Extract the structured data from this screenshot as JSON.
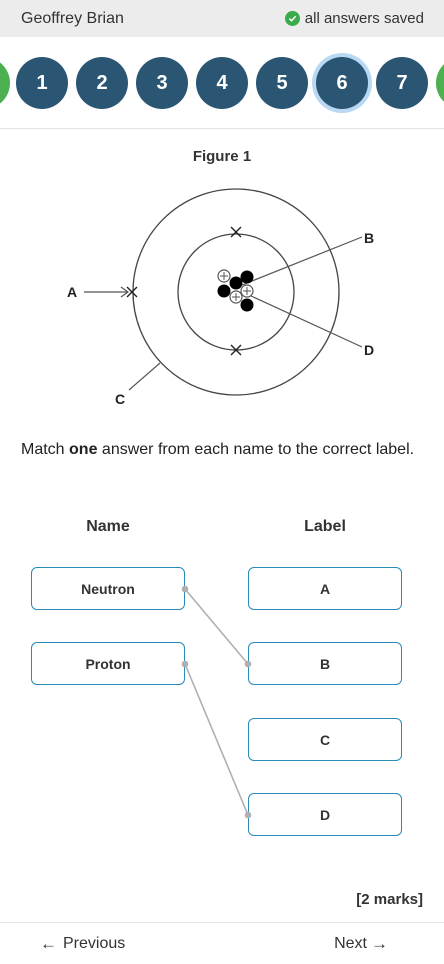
{
  "header": {
    "student_name": "Geoffrey Brian",
    "save_status": "all answers saved"
  },
  "question_nav": {
    "items": [
      "1",
      "2",
      "3",
      "4",
      "5",
      "6",
      "7"
    ],
    "current": "6"
  },
  "figure": {
    "title": "Figure 1",
    "labels": {
      "a": "A",
      "b": "B",
      "c": "C",
      "d": "D"
    }
  },
  "question": {
    "prompt_before": "Match ",
    "prompt_bold": "one",
    "prompt_after": " answer from each name to the correct label."
  },
  "matching": {
    "name_header": "Name",
    "label_header": "Label",
    "names": [
      "Neutron",
      "Proton"
    ],
    "labels": [
      "A",
      "B",
      "C",
      "D"
    ],
    "links": [
      {
        "name": "Neutron",
        "label": "B"
      },
      {
        "name": "Proton",
        "label": "D"
      }
    ]
  },
  "marks": "[2 marks]",
  "footer": {
    "previous_label": "Previous",
    "next_label": "Next"
  },
  "colors": {
    "nav_circle": "#2b5673",
    "current_ring": "#b9d8f4",
    "box_border": "#2a8ab8",
    "saved_check": "#3aaa4a"
  }
}
